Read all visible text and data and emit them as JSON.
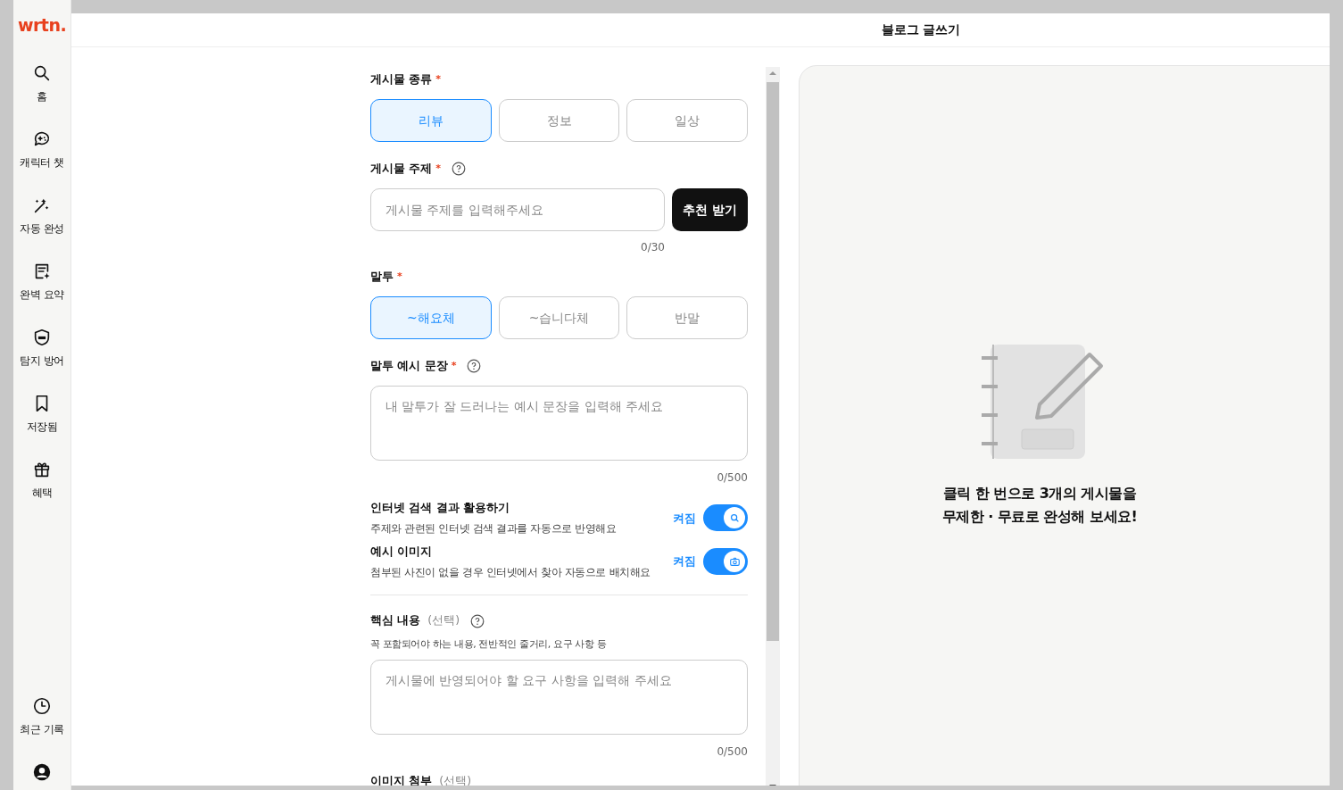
{
  "sidebar": {
    "logo": "wrtn.",
    "items": [
      {
        "label": "홈",
        "kind": "search"
      },
      {
        "label": "캐릭터 챗",
        "kind": "chat"
      },
      {
        "label": "자동 완성",
        "kind": "wand"
      },
      {
        "label": "완벽 요약",
        "kind": "summary"
      },
      {
        "label": "탐지 방어",
        "kind": "shield"
      },
      {
        "label": "저장됨",
        "kind": "bookmark"
      },
      {
        "label": "혜택",
        "kind": "gift"
      }
    ],
    "bottom_items": [
      {
        "label": "최근 기록",
        "kind": "clock"
      },
      {
        "kind": "profile"
      }
    ]
  },
  "header": {
    "title": "블로그 글쓰기"
  },
  "form": {
    "post_type": {
      "label": "게시물 종류",
      "required_mark": "*",
      "options": [
        {
          "label": "리뷰",
          "selected": true
        },
        {
          "label": "정보",
          "selected": false
        },
        {
          "label": "일상",
          "selected": false
        }
      ]
    },
    "topic": {
      "label": "게시물 주제",
      "required_mark": "*",
      "help": true,
      "placeholder": "게시물 주제를 입력해주세요",
      "button": "추천 받기",
      "counter": "0/30"
    },
    "tone": {
      "label": "말투",
      "required_mark": "*",
      "options": [
        {
          "label": "~해요체",
          "selected": true
        },
        {
          "label": "~습니다체",
          "selected": false
        },
        {
          "label": "반말",
          "selected": false
        }
      ]
    },
    "tone_example": {
      "label": "말투 예시 문장",
      "required_mark": "*",
      "help": true,
      "placeholder": "내 말투가 잘 드러나는 예시 문장을 입력해 주세요",
      "counter": "0/500"
    },
    "toggles": [
      {
        "title": "인터넷 검색 결과 활용하기",
        "description": "주제와 관련된 인터넷 검색 결과를 자동으로 반영해요",
        "state_label": "켜짐",
        "on": true,
        "kind": "search"
      },
      {
        "title": "예시 이미지",
        "description": "첨부된 사진이 없을 경우 인터넷에서 찾아 자동으로 배치해요",
        "state_label": "켜짐",
        "on": true,
        "kind": "image"
      }
    ],
    "key_content": {
      "label": "핵심 내용",
      "optional": "(선택)",
      "help": true,
      "hint": "꼭 포함되어야 하는 내용, 전반적인 줄거리, 요구 사항 등",
      "placeholder": "게시물에 반영되어야 할 요구 사항을 입력해 주세요",
      "counter": "0/500"
    },
    "image_attach": {
      "label": "이미지 첨부",
      "optional": "(선택)"
    }
  },
  "preview": {
    "message_lines": [
      "클릭 한 번으로 3개의 게시물을",
      "무제한 · 무료로 완성해 보세요!"
    ]
  }
}
